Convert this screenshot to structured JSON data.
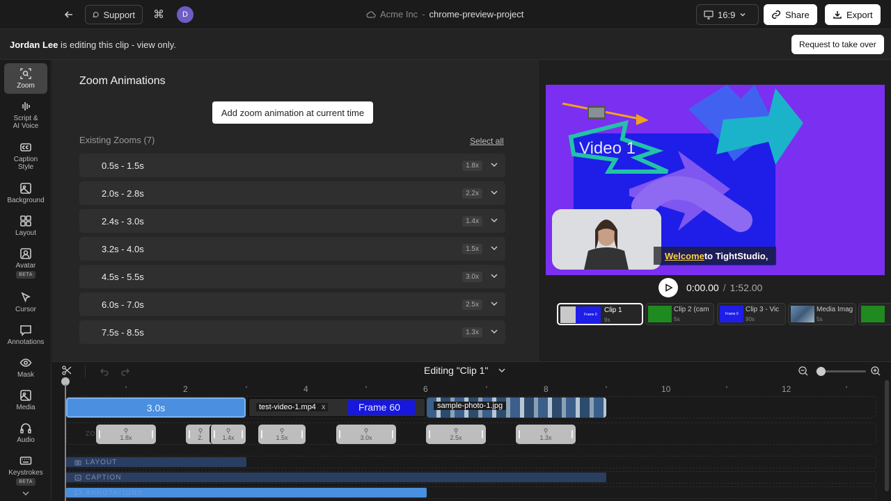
{
  "topbar": {
    "support_label": "Support",
    "avatar_letter": "D",
    "org": "Acme Inc",
    "separator": "-",
    "project": "chrome-preview-project",
    "aspect": "16:9",
    "share_label": "Share",
    "export_label": "Export"
  },
  "banner": {
    "user": "Jordan Lee",
    "message": " is editing this clip - view only.",
    "takeover_label": "Request to take over"
  },
  "sidebar": {
    "items": [
      {
        "label": "Zoom",
        "icon": "zoom-icon"
      },
      {
        "label": "Script &\nAI Voice",
        "icon": "waveform-icon"
      },
      {
        "label": "Caption\nStyle",
        "icon": "cc-icon"
      },
      {
        "label": "Background",
        "icon": "image-icon"
      },
      {
        "label": "Layout",
        "icon": "grid-icon"
      },
      {
        "label": "Avatar",
        "icon": "avatar-icon",
        "badge": "BETA"
      },
      {
        "label": "Cursor",
        "icon": "cursor-icon"
      },
      {
        "label": "Annotations",
        "icon": "annotation-icon"
      },
      {
        "label": "Mask",
        "icon": "eye-icon"
      },
      {
        "label": "Media",
        "icon": "media-icon"
      },
      {
        "label": "Audio",
        "icon": "headphones-icon"
      },
      {
        "label": "Keystrokes",
        "icon": "keyboard-icon",
        "badge": "BETA"
      }
    ]
  },
  "zoom_panel": {
    "title": "Zoom Animations",
    "add_label": "Add zoom animation at current time",
    "existing_label": "Existing Zooms (7)",
    "select_all": "Select all",
    "zooms": [
      {
        "range": "0.5s - 1.5s",
        "scale": "1.8x"
      },
      {
        "range": "2.0s - 2.8s",
        "scale": "2.2x"
      },
      {
        "range": "2.4s - 3.0s",
        "scale": "1.4x"
      },
      {
        "range": "3.2s - 4.0s",
        "scale": "1.5x"
      },
      {
        "range": "4.5s - 5.5s",
        "scale": "3.0x"
      },
      {
        "range": "6.0s - 7.0s",
        "scale": "2.5x"
      },
      {
        "range": "7.5s - 8.5s",
        "scale": "1.3x"
      }
    ]
  },
  "preview": {
    "video_text": "Video 1",
    "caption_highlight": "Welcome",
    "caption_rest": " to TightStudio,",
    "time_current": "0:00.00",
    "time_sep": "/",
    "time_total": "1:52.00",
    "clips": [
      {
        "title": "Clip 1",
        "duration": "9s",
        "thumb_text": "Frame 0"
      },
      {
        "title": "Clip 2 (cam",
        "duration": "5s",
        "thumb_text": ""
      },
      {
        "title": "Clip 3 - Vic",
        "duration": "90s",
        "thumb_text": "Frame 0"
      },
      {
        "title": "Media Imag",
        "duration": "5s",
        "thumb_text": ""
      },
      {
        "title": "",
        "duration": "",
        "thumb_text": ""
      }
    ]
  },
  "timeline": {
    "editing_label": "Editing \"Clip 1\"",
    "ticks": [
      "2",
      "4",
      "6",
      "8",
      "10",
      "12"
    ],
    "clip_zoom_label": "3.0s",
    "video_clip_label": "test-video-1.mp4",
    "video_close": "x",
    "frame_label": "Frame 60",
    "photo_label": "sample-photo-1.jpg",
    "zoom_row_label": "ZO",
    "zoom_chips": [
      "1.8x",
      "2.",
      "1.4x",
      "1.5x",
      "3.0x",
      "2.5x",
      "1.3x"
    ],
    "layers": [
      "LAYOUT",
      "CAPTION",
      "ANNOTATIONS"
    ],
    "zoom_slider_level": 0.1
  },
  "colors": {
    "accent_blue": "#4a8fe0",
    "video_bg": "#7b2ff0",
    "video_blue": "#1e1ee8",
    "teal": "#1bb3c9",
    "orange": "#f2a31a"
  }
}
